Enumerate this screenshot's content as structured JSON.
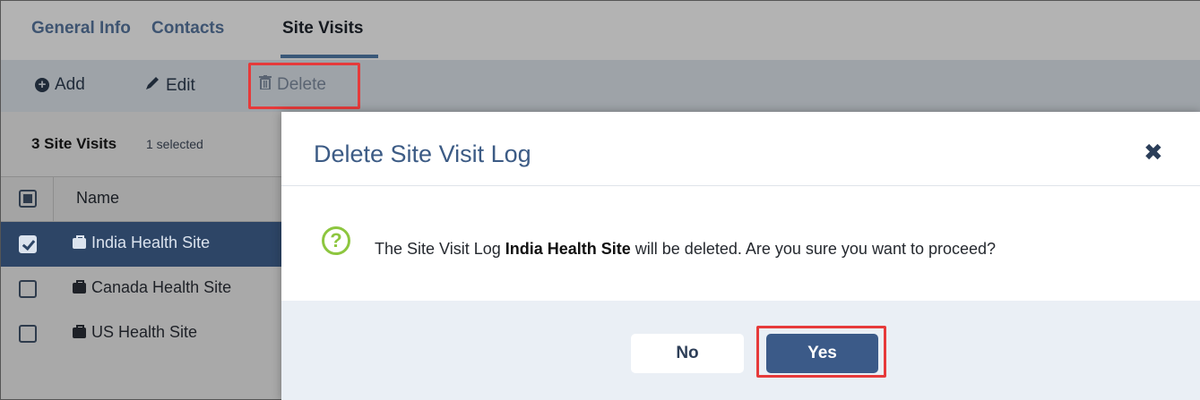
{
  "tabs": [
    {
      "label": "General Info"
    },
    {
      "label": "Contacts"
    },
    {
      "label": "Site Visits",
      "active": true
    }
  ],
  "toolbar": {
    "add_label": "Add",
    "edit_label": "Edit",
    "delete_label": "Delete"
  },
  "list": {
    "count_label": "3 Site Visits",
    "selected_label": "1 selected",
    "column_name": "Name",
    "rows": [
      {
        "label": "India Health Site",
        "checked": true
      },
      {
        "label": "Canada Health Site",
        "checked": false
      },
      {
        "label": "US Health Site",
        "checked": false
      }
    ]
  },
  "modal": {
    "title": "Delete Site Visit Log",
    "close_glyph": "✖",
    "message_prefix": "The Site Visit Log ",
    "message_item": "India Health Site",
    "message_suffix": " will be deleted. Are you sure you want to proceed?",
    "no_label": "No",
    "yes_label": "Yes"
  },
  "colors": {
    "accent": "#3b5a88",
    "highlight": "#e63a3a",
    "question_icon": "#8dc63f"
  }
}
